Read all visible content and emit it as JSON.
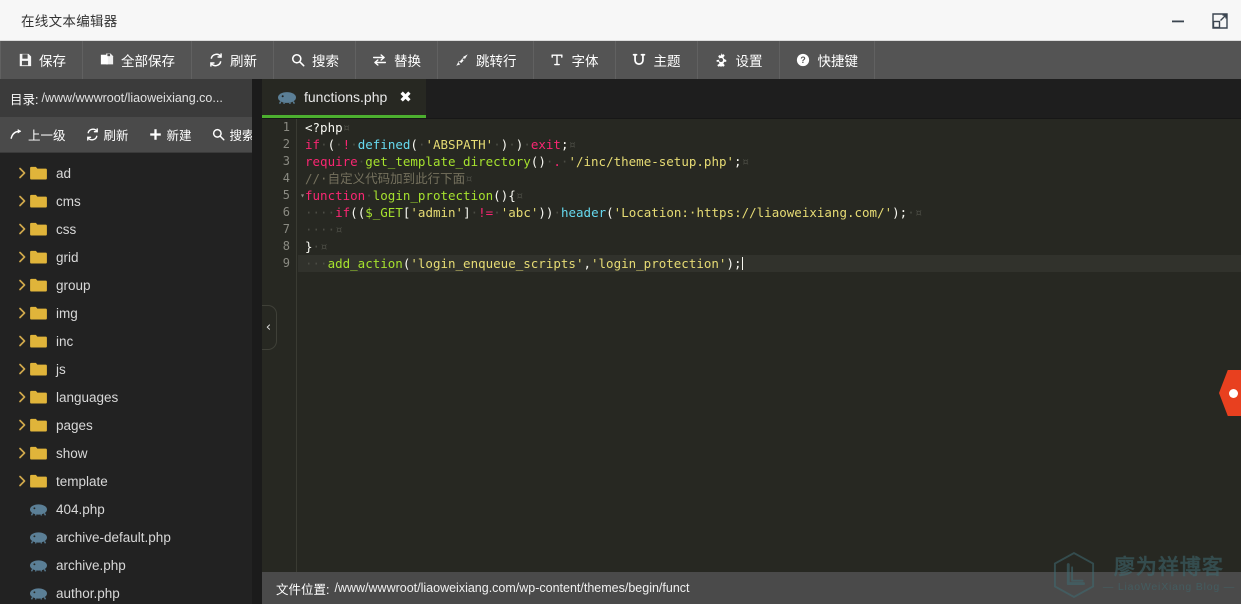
{
  "window": {
    "title": "在线文本编辑器",
    "minimize_label": "minimize",
    "maximize_label": "maximize"
  },
  "toolbar": {
    "items": [
      {
        "label": "保存",
        "icon": "save-icon"
      },
      {
        "label": "全部保存",
        "icon": "save-all-icon"
      },
      {
        "label": "刷新",
        "icon": "refresh-icon"
      },
      {
        "label": "搜索",
        "icon": "search-icon"
      },
      {
        "label": "替换",
        "icon": "replace-icon"
      },
      {
        "label": "跳转行",
        "icon": "goto-line-icon"
      },
      {
        "label": "字体",
        "icon": "font-icon"
      },
      {
        "label": "主题",
        "icon": "theme-icon"
      },
      {
        "label": "设置",
        "icon": "gear-icon"
      },
      {
        "label": "快捷键",
        "icon": "help-icon"
      }
    ]
  },
  "sidebar": {
    "directory": {
      "label": "目录:",
      "path": "/www/wwwroot/liaoweixiang.co..."
    },
    "tools": [
      {
        "label": "上一级",
        "icon": "up-level-icon"
      },
      {
        "label": "刷新",
        "icon": "refresh-icon"
      },
      {
        "label": "新建",
        "icon": "plus-icon"
      },
      {
        "label": "搜索",
        "icon": "search-icon"
      }
    ],
    "tree": [
      {
        "name": "ad",
        "type": "folder"
      },
      {
        "name": "cms",
        "type": "folder"
      },
      {
        "name": "css",
        "type": "folder"
      },
      {
        "name": "grid",
        "type": "folder"
      },
      {
        "name": "group",
        "type": "folder"
      },
      {
        "name": "img",
        "type": "folder"
      },
      {
        "name": "inc",
        "type": "folder"
      },
      {
        "name": "js",
        "type": "folder"
      },
      {
        "name": "languages",
        "type": "folder"
      },
      {
        "name": "pages",
        "type": "folder"
      },
      {
        "name": "show",
        "type": "folder"
      },
      {
        "name": "template",
        "type": "folder"
      },
      {
        "name": "404.php",
        "type": "php"
      },
      {
        "name": "archive-default.php",
        "type": "php"
      },
      {
        "name": "archive.php",
        "type": "php"
      },
      {
        "name": "author.php",
        "type": "php"
      }
    ]
  },
  "editor": {
    "tabs": [
      {
        "label": "functions.php",
        "icon": "php-icon",
        "close_label": "✖",
        "active": true
      }
    ],
    "collapse_handle_label": "‹",
    "active_line": 9,
    "line_numbers": [
      "1",
      "2",
      "3",
      "4",
      "5",
      "6",
      "7",
      "8",
      "9"
    ],
    "fold_line": "5",
    "lines": [
      "<?php",
      "if ( ! defined( 'ABSPATH' ) ) exit;",
      "require get_template_directory() . '/inc/theme-setup.php';",
      "// 自定义代码加到此行下面",
      "function login_protection(){",
      "    if(($_GET['admin'] != 'abc')) header('Location: https://liaoweixiang.com/');",
      "    ",
      "}",
      "    add_action('login_enqueue_scripts','login_protection');"
    ]
  },
  "statusbar": {
    "label": "文件位置:",
    "value": "/www/wwwroot/liaoweixiang.com/wp-content/themes/begin/funct"
  },
  "watermark": {
    "cn": "廖为祥博客",
    "en": "— LiaoWeiXiang Blog —",
    "logo_letter": "L"
  },
  "side_badge": {
    "name": "feedback-tab"
  },
  "colors": {
    "accent_green": "#4caf2f",
    "toolbar_bg": "#545454",
    "sidebar_bg": "#222222",
    "editor_bg": "#272822",
    "folder_yellow": "#e0b43a",
    "php_blue": "#5b7f96",
    "badge_red": "#e8401f"
  }
}
